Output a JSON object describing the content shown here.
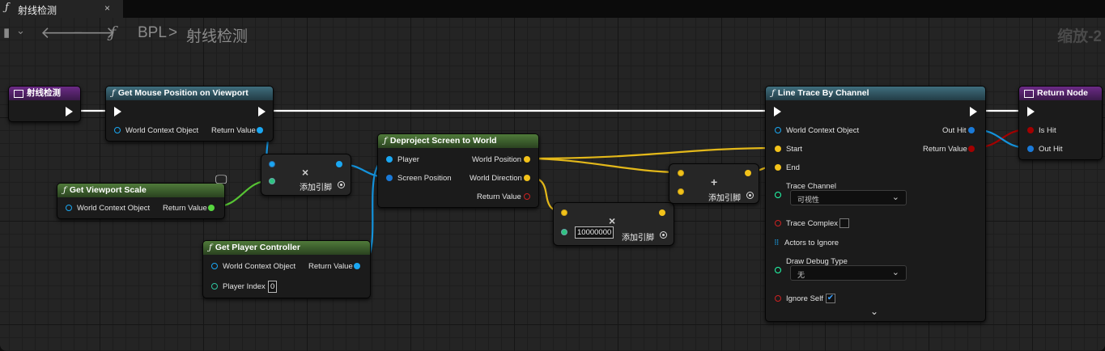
{
  "tab": {
    "icon": "function-icon",
    "title": "射线检测",
    "close": "×"
  },
  "toolbar": {
    "bookmark_icon": "bookmark-icon",
    "back_icon": "arrow-left-icon",
    "forward_icon": "arrow-right-icon",
    "func_icon": "ƒ",
    "breadcrumb_root": "BPL",
    "breadcrumb_sep": ">",
    "breadcrumb_current": "射线检测",
    "zoom": "缩放-2"
  },
  "colors": {
    "exec": "#ffffff",
    "object_pin": "#1aa7f2",
    "float_pin": "#57d63f",
    "vector_pin": "#f2c21a",
    "bool_pin": "#a30000",
    "wire_exec": "#ffffff",
    "wire_vector": "#e3b81a",
    "wire_object": "#1493dc",
    "wire_float": "#57c434"
  },
  "nodes": {
    "entry": {
      "title": "射线检测"
    },
    "get_mouse": {
      "title": "Get Mouse Position on Viewport",
      "in1": "World Context Object",
      "out1": "Return Value"
    },
    "get_viewport_scale": {
      "title": "Get Viewport Scale",
      "in1": "World Context Object",
      "out1": "Return Value"
    },
    "get_player_controller": {
      "title": "Get Player Controller",
      "in1": "World Context Object",
      "in2": "Player Index",
      "player_index": "0",
      "out1": "Return Value"
    },
    "divide": {
      "symbol": "×",
      "label": "添加引脚"
    },
    "deproject": {
      "title": "Deproject Screen to World",
      "in1": "Player",
      "in2": "Screen Position",
      "out1": "World Position",
      "out2": "World Direction",
      "out3": "Return Value"
    },
    "multiply": {
      "symbol": "×",
      "value": "10000000",
      "label": "添加引脚"
    },
    "add": {
      "symbol": "+",
      "label": "添加引脚"
    },
    "line_trace": {
      "title": "Line Trace By Channel",
      "in1": "World Context Object",
      "in2": "Start",
      "in3": "End",
      "trace_channel_label": "Trace Channel",
      "trace_channel_value": "可视性",
      "trace_complex": "Trace Complex",
      "actors_to_ignore": "Actors to Ignore",
      "draw_debug_label": "Draw Debug Type",
      "draw_debug_value": "无",
      "ignore_self": "Ignore Self",
      "out1": "Out Hit",
      "out2": "Return Value"
    },
    "return": {
      "title": "Return Node",
      "in1": "Is Hit",
      "in2": "Out Hit"
    }
  }
}
